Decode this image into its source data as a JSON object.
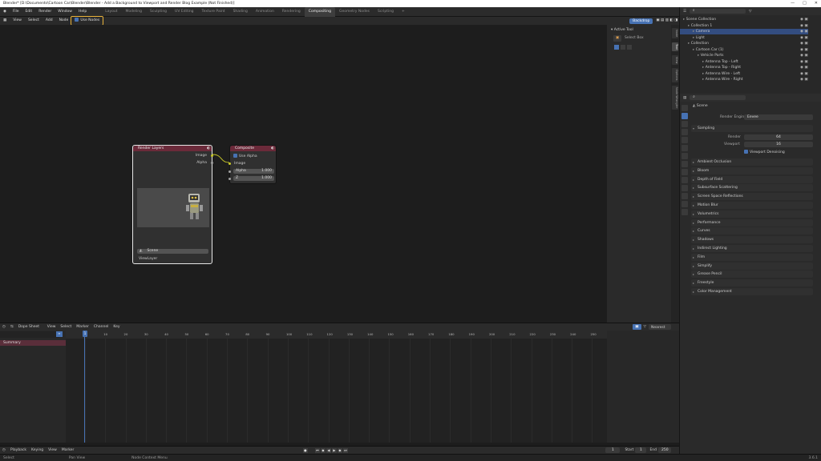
{
  "window": {
    "title": "Blender* [D:\\Documents\\Cartoon Car\\Blender\\Blender - Add a Background to Viewport and Render Blog Example (Not Finished)]"
  },
  "menubar": {
    "menus": [
      "File",
      "Edit",
      "Render",
      "Window",
      "Help"
    ],
    "workspaces": [
      "Layout",
      "Modeling",
      "Sculpting",
      "UV Editing",
      "Texture Paint",
      "Shading",
      "Animation",
      "Rendering",
      "Compositing",
      "Geometry Nodes",
      "Scripting"
    ],
    "active_workspace": "Compositing",
    "scene_label": "Scene",
    "viewlayer_label": "ViewLayer"
  },
  "node_editor": {
    "menus": [
      "View",
      "Select",
      "Add",
      "Node"
    ],
    "use_nodes_label": "Use Nodes",
    "backdrop_label": "Backdrop",
    "breadcrumb": [
      "Scene",
      "Compositing Nodetree"
    ],
    "render_layers": {
      "title": "Render Layers",
      "outputs": [
        "Image",
        "Alpha"
      ],
      "scene_value": "Scene",
      "layer_value": "ViewLayer"
    },
    "composite": {
      "title": "Composite",
      "use_alpha_label": "Use Alpha",
      "input_image": "Image",
      "alpha_label": "Alpha",
      "alpha_value": "1.000",
      "z_label": "Z",
      "z_value": "1.000"
    },
    "npanel": {
      "section": "Active Tool",
      "tool_label": "Select Box",
      "tabs": [
        "Node",
        "Tool",
        "View",
        "Options",
        "Node Wrangler"
      ]
    }
  },
  "outliner": {
    "header": "Scene Collection",
    "rows": [
      {
        "label": "Scene Collection",
        "indent": 0
      },
      {
        "label": "Collection 1",
        "indent": 1
      },
      {
        "label": "Camera",
        "indent": 2,
        "selected": true
      },
      {
        "label": "Light",
        "indent": 2
      },
      {
        "label": "Collection",
        "indent": 1
      },
      {
        "label": "Cartoon Car (1)",
        "indent": 2
      },
      {
        "label": "Vehicle Parts",
        "indent": 3
      },
      {
        "label": "Antenna Top - Left",
        "indent": 4
      },
      {
        "label": "Antenna Top - Right",
        "indent": 4
      },
      {
        "label": "Antenna Wire - Left",
        "indent": 4
      },
      {
        "label": "Antenna Wire - Right",
        "indent": 4
      }
    ]
  },
  "properties": {
    "context": "Scene",
    "render_engine_label": "Render Engine",
    "render_engine_value": "Eevee",
    "sampling": {
      "title": "Sampling",
      "render_label": "Render",
      "render_value": "64",
      "viewport_label": "Viewport",
      "viewport_value": "16",
      "denoise_label": "Viewport Denoising"
    },
    "panels": [
      "Ambient Occlusion",
      "Bloom",
      "Depth of Field",
      "Subsurface Scattering",
      "Screen Space Reflections",
      "Motion Blur",
      "Volumetrics",
      "Performance",
      "Curves",
      "Shadows",
      "Indirect Lighting",
      "Film",
      "Simplify",
      "Grease Pencil",
      "Freestyle",
      "Color Management"
    ]
  },
  "timeline": {
    "editor": "Dope Sheet",
    "menus": [
      "View",
      "Select",
      "Marker",
      "Channel",
      "Key"
    ],
    "channel": "Summary",
    "mode": "Nearest Frame",
    "current_frame": "1",
    "ticks": [
      "1",
      "10",
      "20",
      "30",
      "40",
      "50",
      "60",
      "70",
      "80",
      "90",
      "100",
      "110",
      "120",
      "130",
      "140",
      "150",
      "160",
      "170",
      "180",
      "190",
      "200",
      "210",
      "220",
      "230",
      "240",
      "250"
    ],
    "playback_menus": [
      "Playback",
      "Keying",
      "View",
      "Marker"
    ],
    "start_label": "Start",
    "start_value": "1",
    "end_label": "End",
    "end_value": "250",
    "frame_field": "1"
  },
  "statusbar": {
    "select": "Select",
    "pan": "Pan View",
    "context": "Node Context Menu",
    "version": "3.6.1"
  },
  "colors": {
    "accent": "#4772b3",
    "highlight": "#e8b23a",
    "node_header": "#6b2a3a",
    "socket_yellow": "#c7c729"
  }
}
